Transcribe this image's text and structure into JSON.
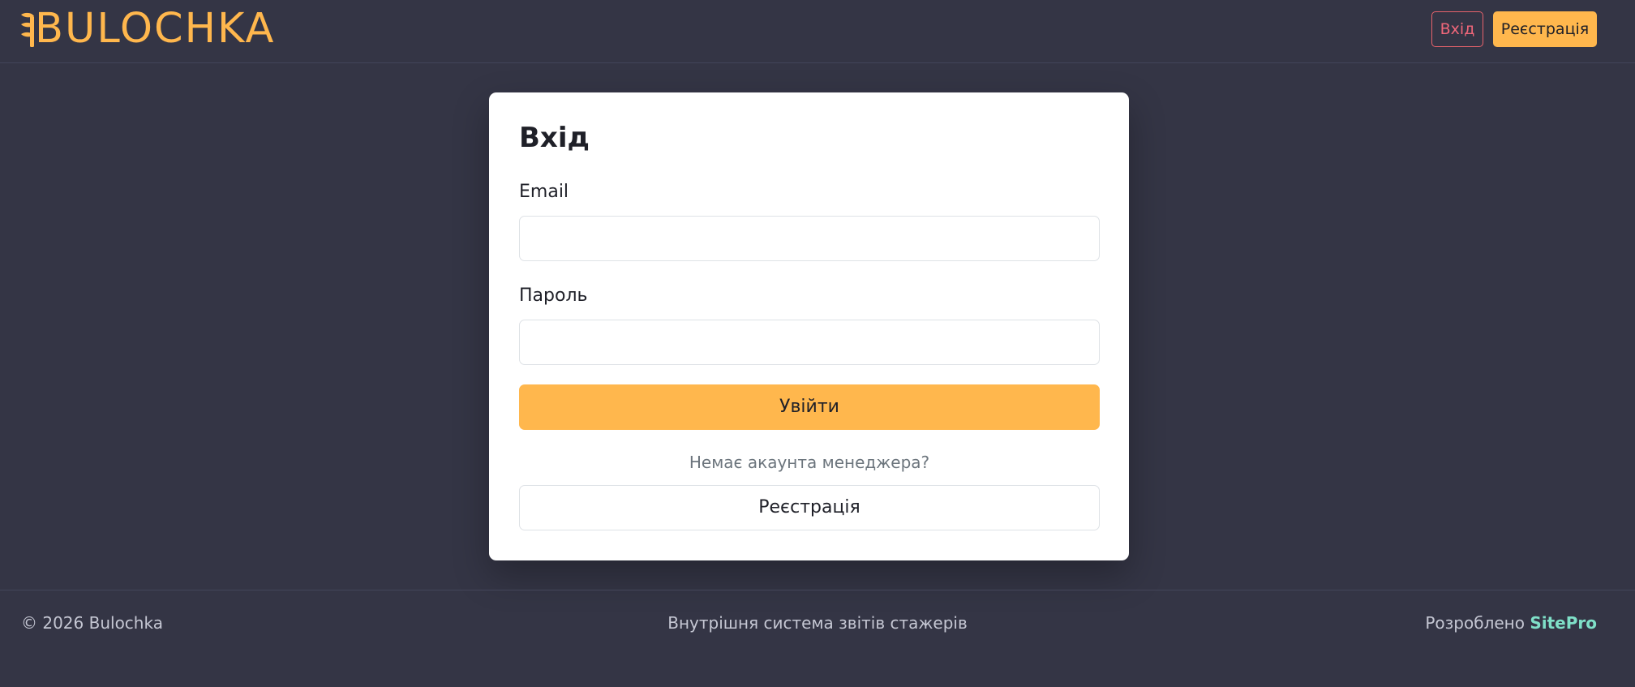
{
  "header": {
    "logo_text": "BULOCHKA",
    "login_label": "Вхід",
    "register_label": "Реєстрація"
  },
  "login_card": {
    "title": "Вхід",
    "email_label": "Email",
    "email_value": "",
    "password_label": "Пароль",
    "password_value": "",
    "submit_label": "Увійти",
    "no_account_text": "Немає акаунта менеджера?",
    "register_label": "Реєстрація"
  },
  "footer": {
    "copyright": "© 2026 Bulochka",
    "system_note": "Внутрішня система звітів стажерів",
    "developed_by": "Розроблено",
    "developer_link": "SitePro"
  },
  "colors": {
    "background": "#343545",
    "accent": "#FFB74D",
    "login_outline": "#e8636c",
    "link": "#7fe0c8",
    "card": "#ffffff"
  },
  "icons": {
    "logo_mark": "wheat-icon"
  }
}
